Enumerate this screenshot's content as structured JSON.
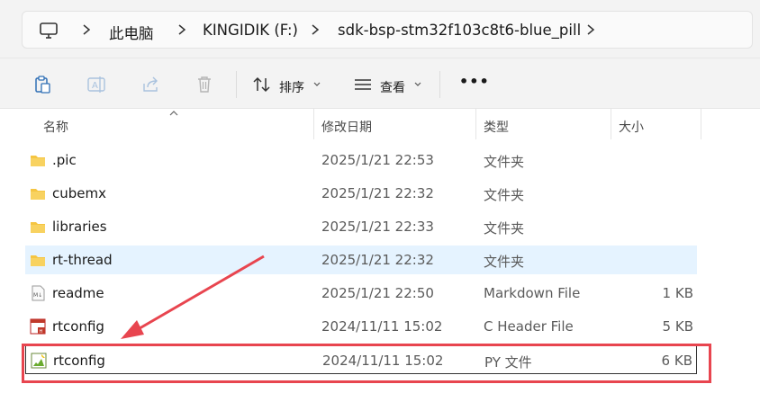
{
  "address_bar": {
    "crumbs": [
      "此电脑",
      "KINGIDIK (F:)",
      "sdk-bsp-stm32f103c8t6-blue_pill"
    ]
  },
  "toolbar": {
    "sort_label": "排序",
    "view_label": "查看",
    "more_label": "•••"
  },
  "columns": {
    "name": "名称",
    "date": "修改日期",
    "type": "类型",
    "size": "大小"
  },
  "files": [
    {
      "name": ".pic",
      "date": "2025/1/21 22:53",
      "type": "文件夹",
      "size": "",
      "icon": "folder-icon"
    },
    {
      "name": "cubemx",
      "date": "2025/1/21 22:32",
      "type": "文件夹",
      "size": "",
      "icon": "folder-icon"
    },
    {
      "name": "libraries",
      "date": "2025/1/21 22:33",
      "type": "文件夹",
      "size": "",
      "icon": "folder-icon"
    },
    {
      "name": "rt-thread",
      "date": "2025/1/21 22:32",
      "type": "文件夹",
      "size": "",
      "icon": "folder-icon"
    },
    {
      "name": "readme",
      "date": "2025/1/21 22:50",
      "type": "Markdown File",
      "size": "1 KB",
      "icon": "markdown-file-icon"
    },
    {
      "name": "rtconfig",
      "date": "2024/11/11 15:02",
      "type": "C Header File",
      "size": "5 KB",
      "icon": "c-header-file-icon"
    },
    {
      "name": "rtconfig",
      "date": "2024/11/11 15:02",
      "type": "PY 文件",
      "size": "6 KB",
      "icon": "python-file-icon"
    }
  ],
  "colors": {
    "selected_row": "#e5f3ff",
    "annotation_red": "#e8454f",
    "folder_yellow": "#f5c542"
  }
}
